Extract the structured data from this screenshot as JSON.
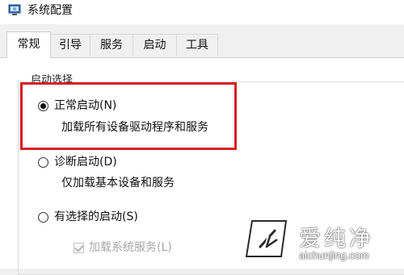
{
  "window": {
    "title": "系统配置",
    "icon": "system-config-icon"
  },
  "tabs": [
    {
      "label": "常规",
      "active": true
    },
    {
      "label": "引导",
      "active": false
    },
    {
      "label": "服务",
      "active": false
    },
    {
      "label": "启动",
      "active": false
    },
    {
      "label": "工具",
      "active": false
    }
  ],
  "startup_selection": {
    "legend": "启动选择",
    "options": [
      {
        "label": "正常启动(N)",
        "description": "加载所有设备驱动程序和服务",
        "selected": true
      },
      {
        "label": "诊断启动(D)",
        "description": "仅加载基本设备和服务",
        "selected": false
      },
      {
        "label": "有选择的启动(S)",
        "description": "",
        "selected": false
      }
    ],
    "sub_option": {
      "label": "加载系统服务(L)",
      "checked": true,
      "disabled": true
    }
  },
  "annotation": {
    "highlight_color": "#d71f26"
  },
  "watermark": {
    "brand": "爱纯净",
    "url": "aichunjing.com"
  }
}
